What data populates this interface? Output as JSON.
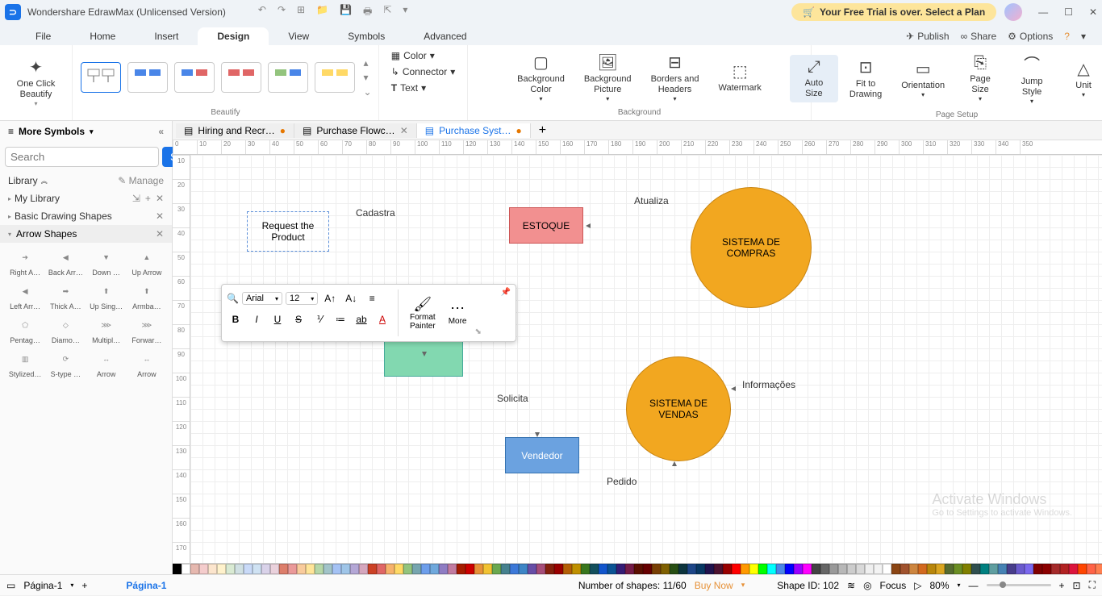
{
  "app": {
    "title": "Wondershare EdrawMax (Unlicensed Version)"
  },
  "trial": {
    "label": "Your Free Trial is over. Select a Plan"
  },
  "menu": {
    "tabs": [
      "File",
      "Home",
      "Insert",
      "Design",
      "View",
      "Symbols",
      "Advanced"
    ],
    "active": 3,
    "right": {
      "publish": "Publish",
      "share": "Share",
      "options": "Options"
    }
  },
  "ribbon": {
    "beautify": {
      "one_click": "One Click\nBeautify",
      "label": "Beautify"
    },
    "quick": {
      "color": "Color",
      "connector": "Connector",
      "text": "Text"
    },
    "bg": {
      "bg_color": "Background\nColor",
      "bg_pic": "Background\nPicture",
      "borders": "Borders and\nHeaders",
      "watermark": "Watermark",
      "label": "Background"
    },
    "page": {
      "auto_size": "Auto\nSize",
      "fit": "Fit to\nDrawing",
      "orientation": "Orientation",
      "page_size": "Page\nSize",
      "jump_style": "Jump\nStyle",
      "unit": "Unit",
      "label": "Page Setup"
    }
  },
  "left": {
    "more": "More Symbols",
    "search_placeholder": "Search",
    "search_btn": "Search",
    "library": "Library",
    "manage": "Manage",
    "my_library": "My Library",
    "basic": "Basic Drawing Shapes",
    "section": "Arrow Shapes",
    "shapes": [
      "Right A…",
      "Back Arr…",
      "Down …",
      "Up Arrow",
      "Left Arr…",
      "Thick A…",
      "Up Sing…",
      "Armba…",
      "Pentag…",
      "Diamo…",
      "Multipl…",
      "Forwar…",
      "Stylized…",
      "S-type …",
      "Arrow",
      "Arrow"
    ]
  },
  "docs": {
    "tabs": [
      {
        "title": "Hiring and Recr…",
        "dirty": true,
        "active": false,
        "close": false
      },
      {
        "title": "Purchase Flowc…",
        "dirty": false,
        "active": false,
        "close": true
      },
      {
        "title": "Purchase Syst…",
        "dirty": true,
        "active": true,
        "close": false
      }
    ]
  },
  "canvas": {
    "request": "Request the\nProduct",
    "estoque": "ESTOQUE",
    "compras": "SISTEMA DE\nCOMPRAS",
    "vendas": "SISTEMA DE\nVENDAS",
    "vendedor": "Vendedor",
    "cadastra": "Cadastra",
    "atualiza": "Atualiza",
    "solicita": "Solicita",
    "informacoes": "Informações",
    "pedido": "Pedido"
  },
  "floatbar": {
    "font": "Arial",
    "size": "12",
    "format_painter": "Format\nPainter",
    "more": "More"
  },
  "palette": [
    "#000",
    "#fff",
    "#e6b8af",
    "#f4cccc",
    "#fce5cd",
    "#fff2cc",
    "#d9ead3",
    "#d0e0e3",
    "#c9daf8",
    "#cfe2f3",
    "#d9d2e9",
    "#ead1dc",
    "#dd7e6b",
    "#ea9999",
    "#f9cb9c",
    "#ffe599",
    "#b6d7a8",
    "#a2c4c9",
    "#a4c2f4",
    "#9fc5e8",
    "#b4a7d6",
    "#d5a6bd",
    "#cc4125",
    "#e06666",
    "#f6b26b",
    "#ffd966",
    "#93c47d",
    "#76a5af",
    "#6d9eeb",
    "#6fa8dc",
    "#8e7cc3",
    "#c27ba0",
    "#a61c00",
    "#cc0000",
    "#e69138",
    "#f1c232",
    "#6aa84f",
    "#45818e",
    "#3c78d8",
    "#3d85c6",
    "#674ea7",
    "#a64d79",
    "#85200c",
    "#990000",
    "#b45f06",
    "#bf9000",
    "#38761d",
    "#134f5c",
    "#1155cc",
    "#0b5394",
    "#351c75",
    "#741b47",
    "#5b0f00",
    "#660000",
    "#783f04",
    "#7f6000",
    "#274e13",
    "#0c343d",
    "#1c4587",
    "#073763",
    "#20124d",
    "#4c1130",
    "#980000",
    "#ff0000",
    "#ff9900",
    "#ffff00",
    "#00ff00",
    "#00ffff",
    "#4a86e8",
    "#0000ff",
    "#9900ff",
    "#ff00ff",
    "#434343",
    "#666666",
    "#999999",
    "#b7b7b7",
    "#cccccc",
    "#d9d9d9",
    "#efefef",
    "#f3f3f3",
    "#ffffff",
    "#8b4513",
    "#a0522d",
    "#cd853f",
    "#d2691e",
    "#b8860b",
    "#daa520",
    "#556b2f",
    "#6b8e23",
    "#808000",
    "#2f4f4f",
    "#008080",
    "#5f9ea0",
    "#4682b4",
    "#483d8b",
    "#6a5acd",
    "#7b68ee",
    "#800000",
    "#8b0000",
    "#a52a2a",
    "#b22222",
    "#dc143c",
    "#ff4500",
    "#ff6347",
    "#ff7f50"
  ],
  "status": {
    "pagina_left": "Página-1",
    "pagina": "Página-1",
    "shapes": "Number of shapes: 11/60",
    "buy": "Buy Now",
    "shape_id": "Shape ID: 102",
    "focus": "Focus",
    "zoom": "80%"
  },
  "watermark": {
    "line1": "Activate Windows",
    "line2": "Go to Settings to activate Windows."
  }
}
